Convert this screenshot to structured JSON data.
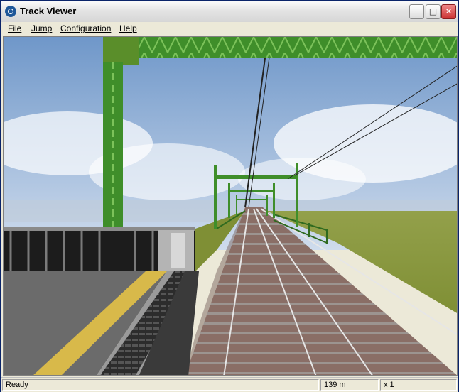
{
  "window": {
    "title": "Track Viewer"
  },
  "controls": {
    "minimize": "_",
    "maximize": "□",
    "close": "✕"
  },
  "menu": {
    "items": [
      "File",
      "Jump",
      "Configuration",
      "Help"
    ]
  },
  "viewport": {
    "colors": {
      "sky_top": "#6f97c9",
      "sky_bottom": "#cfdced",
      "grass": "#8f9a3f",
      "gantry_green": "#3f8e2a",
      "ballast": "#8a6e66",
      "platform": "#6b6b6b",
      "tactile_strip": "#d8b94a"
    }
  },
  "status": {
    "text": "Ready",
    "distance": "139 m",
    "speed": "x 1"
  }
}
